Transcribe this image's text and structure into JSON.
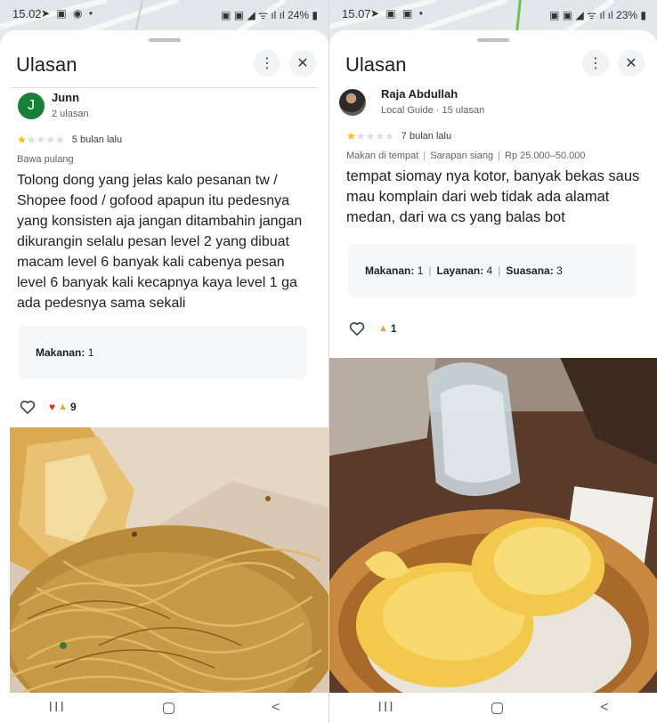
{
  "colors": {
    "accent_star": "#fbbc04",
    "avatar_green": "#188038"
  },
  "panes": [
    {
      "status": {
        "time": "15.02",
        "battery": "24%"
      },
      "title": "Ulasan",
      "reviewer": {
        "initial": "J",
        "name": "Junn",
        "sub": "2 ulasan"
      },
      "rating": {
        "stars": 1,
        "age": "5 bulan lalu"
      },
      "tags": [
        "Bawa pulang"
      ],
      "text": "Tolong dong yang jelas kalo pesanan tw / Shopee food / gofood apapun itu pedesnya yang konsisten aja jangan ditambahin jangan dikurangin selalu pesan level 2 yang dibuat macam level 6 banyak kali cabenya pesan level 6 banyak kali kecapnya kaya level 1 ga ada pedesnya sama sekali",
      "scores": [
        {
          "label": "Makanan:",
          "value": "1"
        }
      ],
      "reactions": {
        "count": "9",
        "icons": [
          "heart",
          "pray"
        ]
      }
    },
    {
      "status": {
        "time": "15.07",
        "battery": "23%"
      },
      "title": "Ulasan",
      "reviewer": {
        "initial": "",
        "name": "Raja Abdullah",
        "sub": "Local Guide · 15 ulasan"
      },
      "rating": {
        "stars": 1,
        "age": "7 bulan lalu"
      },
      "tags": [
        "Makan di tempat",
        "Sarapan siang",
        "Rp 25.000–50.000"
      ],
      "text": "tempat siomay nya kotor, banyak bekas saus mau komplain dari web tidak ada alamat medan, dari wa cs yang balas bot",
      "scores": [
        {
          "label": "Makanan:",
          "value": "1"
        },
        {
          "label": "Layanan:",
          "value": "4"
        },
        {
          "label": "Suasana:",
          "value": "3"
        }
      ],
      "reactions": {
        "count": "1",
        "icons": [
          "pray"
        ]
      }
    }
  ],
  "icons": {
    "more": "more-vert-icon",
    "close": "close-icon",
    "like": "heart-outline-icon"
  },
  "navbar": {
    "recents": "III",
    "back": "<"
  }
}
